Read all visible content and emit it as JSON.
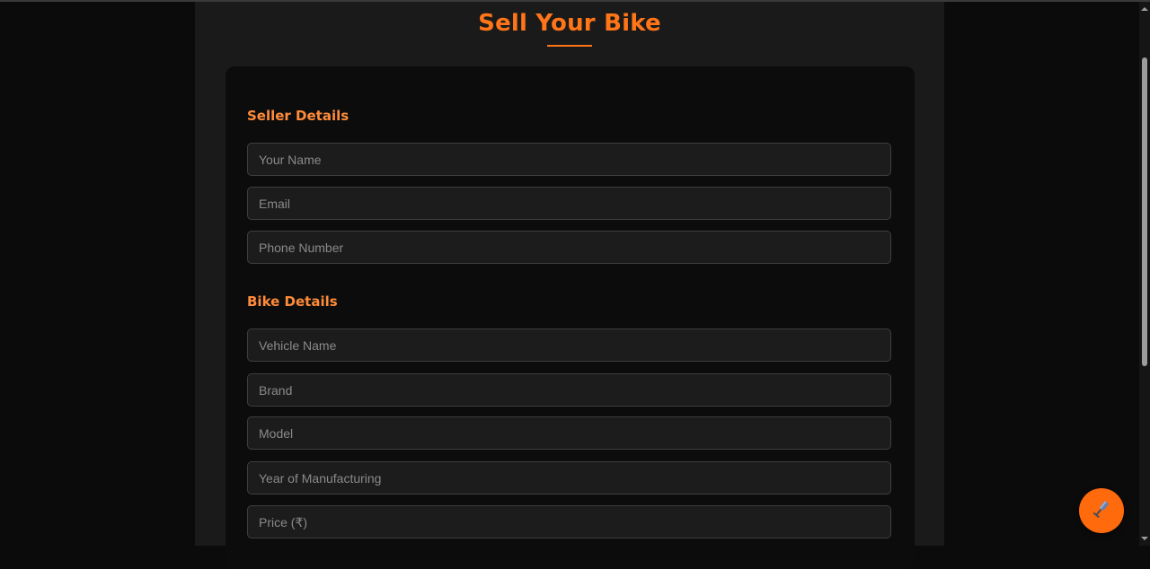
{
  "page": {
    "title": "Sell Your Bike"
  },
  "seller_section": {
    "title": "Seller Details",
    "fields": [
      {
        "placeholder": "Your Name",
        "value": ""
      },
      {
        "placeholder": "Email",
        "value": ""
      },
      {
        "placeholder": "Phone Number",
        "value": ""
      }
    ]
  },
  "bike_section": {
    "title": "Bike Details",
    "fields": [
      {
        "placeholder": "Vehicle Name",
        "value": ""
      },
      {
        "placeholder": "Brand",
        "value": ""
      },
      {
        "placeholder": "Model",
        "value": ""
      },
      {
        "placeholder": "Year of Manufacturing",
        "value": ""
      },
      {
        "placeholder": "Price (₹)",
        "value": ""
      }
    ]
  },
  "fab": {
    "icon": "microphone-icon"
  },
  "colors": {
    "accent": "#ff7518",
    "section_title": "#ff8c3a",
    "background": "#0b0b0b",
    "panel": "#1a1a1a",
    "card": "#0c0c0c",
    "input_bg": "#1c1c1c",
    "input_border": "#3e3e3e"
  }
}
